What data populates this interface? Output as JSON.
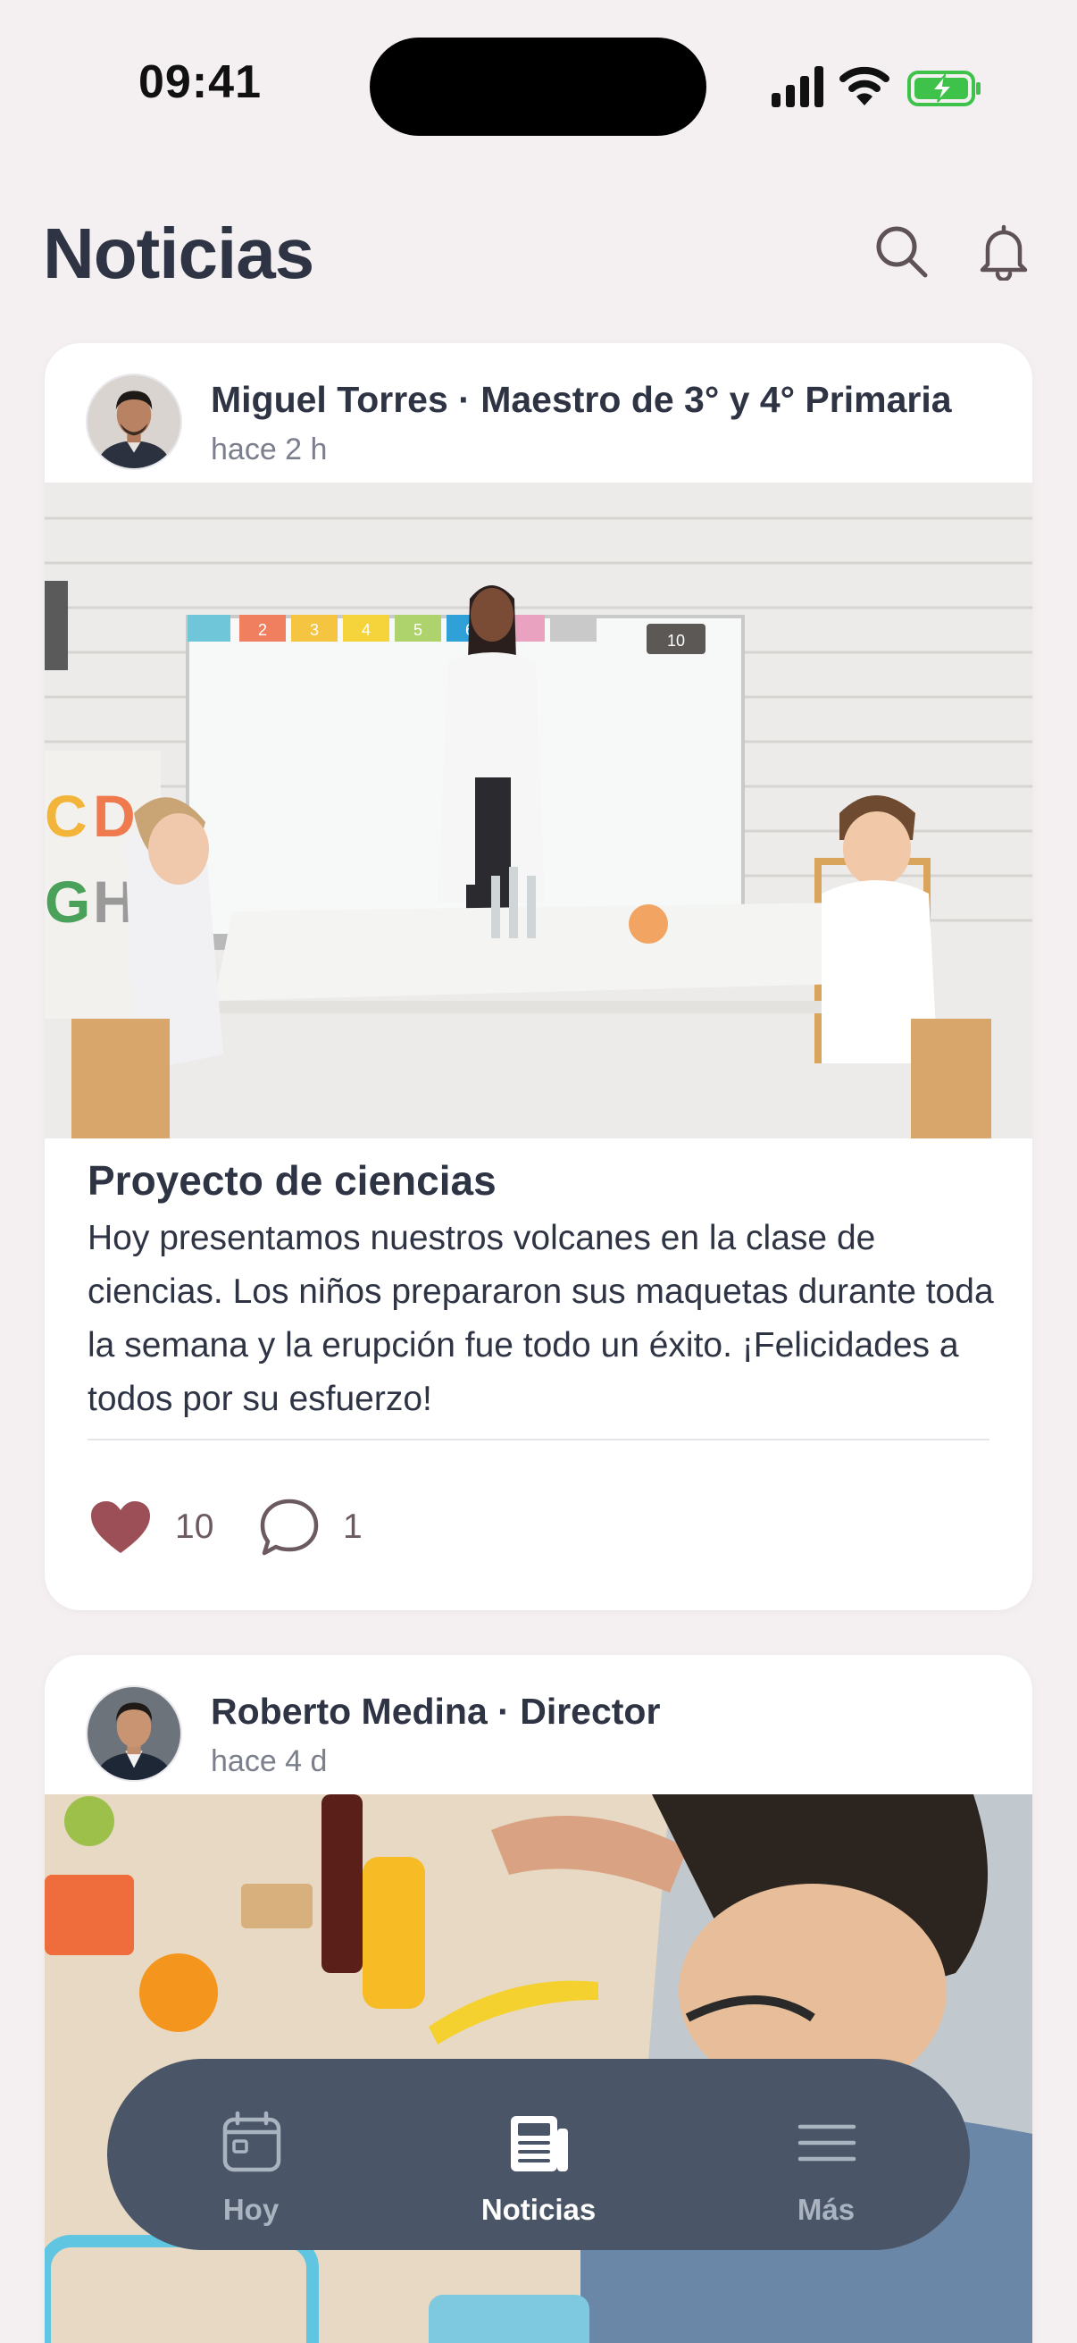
{
  "status_bar": {
    "time": "09:41"
  },
  "header": {
    "title": "Noticias"
  },
  "posts": [
    {
      "author": "Miguel Torres · Maestro de 3° y 4° Primaria",
      "time_ago": "hace 2 h",
      "title": "Proyecto de ciencias",
      "body": "Hoy presentamos nuestros volcanes en la clase de ciencias. Los niños prepararon sus maquetas durante toda la semana y la erupción fue todo un éxito. ¡Felicidades a todos por su esfuerzo!",
      "likes": "10",
      "comments": "1"
    },
    {
      "author": "Roberto Medina · Director",
      "time_ago": "hace 4 d"
    }
  ],
  "photo_1": {
    "train_numbers": [
      "2",
      "3",
      "4",
      "5",
      "6",
      "10"
    ],
    "letters_row1": [
      "C",
      "D"
    ],
    "letters_row2": [
      "G",
      "H"
    ]
  },
  "tabbar": {
    "items": [
      {
        "label": "Hoy",
        "icon": "calendar-icon",
        "active": false
      },
      {
        "label": "Noticias",
        "icon": "newspaper-icon",
        "active": true
      },
      {
        "label": "Más",
        "icon": "menu-icon",
        "active": false
      }
    ]
  },
  "colors": {
    "background": "#f4f0f1",
    "heart": "#9c4f57",
    "tabbar": "#4a5668"
  }
}
